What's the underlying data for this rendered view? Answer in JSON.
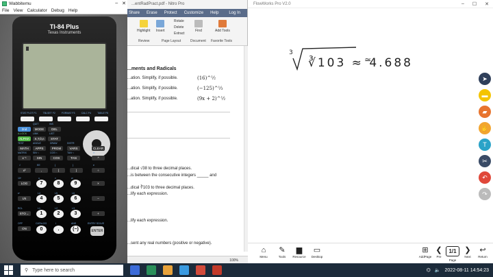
{
  "wabbit": {
    "title": "Wabbitemu",
    "menu": [
      "File",
      "View",
      "Calculator",
      "Debug",
      "Help"
    ],
    "calc": {
      "model": "TI-84 Plus",
      "maker": "Texas Instruments",
      "fn_labels": [
        "STAT PLOT F1",
        "TBLSET F2",
        "FORMAT F3",
        "CALC F4",
        "TABLE F5"
      ],
      "keys": {
        "second": "2nd",
        "mode": "MODE",
        "del": "DEL",
        "alpha": "ALPHA",
        "xton": "X,T,θ,n",
        "stat": "STAT",
        "math": "MATH",
        "apps": "APPS",
        "prgm": "PRGM",
        "vars": "VARS",
        "clear": "CLEAR",
        "xinv": "x⁻¹",
        "sin": "SIN",
        "cos": "COS",
        "tan": "TAN",
        "pow": "^",
        "sq": "x²",
        "comma": ",",
        "lparen": "(",
        "rparen": ")",
        "div": "÷",
        "log": "LOG",
        "n7": "7",
        "n8": "8",
        "n9": "9",
        "mul": "×",
        "ln": "LN",
        "n4": "4",
        "n5": "5",
        "n6": "6",
        "sub": "−",
        "sto": "STO→",
        "n1": "1",
        "n2": "2",
        "n3": "3",
        "add": "+",
        "on": "ON",
        "n0": "0",
        "dot": ".",
        "neg": "(−)",
        "enter": "ENTER"
      },
      "sub": {
        "quit": "QUIT",
        "ins": "INS",
        "alock": "A-LOCK",
        "link": "LINK",
        "list": "LIST",
        "test": "TEST",
        "angle": "ANGLE",
        "draw": "DRAW",
        "distr": "DISTR",
        "matrix": "MATRIX",
        "sininv": "SIN⁻¹",
        "cosinv": "COS⁻¹",
        "taninv": "TAN⁻¹",
        "pi": "π",
        "sqrt": "√",
        "ee": "EE",
        "lbrace": "{",
        "rbrace": "}",
        "e": "e",
        "tenx": "10ˣ",
        "u": "u",
        "v": "v",
        "w": "w",
        "ex": "eˣ",
        "l4": "L4",
        "l5": "L5",
        "l6": "L6",
        "rcl": "RCL",
        "l1": "L1",
        "l2": "L2",
        "l3": "L3",
        "off": "OFF",
        "catalog": "CATALOG",
        "i": "i",
        "ans": "ANS",
        "entry": "ENTRY SOLVE"
      }
    }
  },
  "nitro": {
    "title": "...entRadPract.pdf - Nitro Pro",
    "tabs": [
      "Share",
      "Erase",
      "Protect",
      "Customize",
      "Help",
      "Log In"
    ],
    "ribbon": {
      "highlight": "Highlight",
      "insert": "Insert",
      "rotate": "Rotate",
      "delete": "Delete",
      "extract": "Extract",
      "find": "Find",
      "add_tools": "Add Tools",
      "groups": [
        "Review",
        "Page Layout",
        "Document",
        "Favorite Tools"
      ]
    },
    "doc": {
      "heading": "...ments and Radicals",
      "l1": "...ation.  Simplify, if possible.",
      "l2": "...ation.  Simplify, if possible.",
      "l3": "...ation.  Simplify, if possible.",
      "e1": "(16)^½",
      "e2": "(−125)^⅓",
      "e3": "(9x + 2)^½",
      "l4": "...dical √38 to three decimal places.",
      "l5": "...is between the consecutive integers _____ and",
      "l6": "...dical ∛103 to three decimal places.",
      "l7": "...lify each expression.",
      "l8": "...lify each expression.",
      "l9": "...sent any real numbers (positive or negative)."
    },
    "status": {
      "zoom": "100%"
    }
  },
  "flow": {
    "title": "FlowWorks Pro V2.0",
    "math": "∛103 ≈ 4.688",
    "bottom": [
      "Menu",
      "Tools",
      "Resource",
      "Desktop",
      "AddPage",
      "Pre",
      "Page",
      "Next",
      "Return"
    ],
    "page": "1/1"
  },
  "taskbar": {
    "search_placeholder": "Type here to search",
    "datetime": "2022-08-11  14:54:23"
  },
  "colors": {
    "nitro_tabs": "#5a6c8a",
    "taskbar": "#1c2b3a",
    "calc_screen": "#aab49a"
  }
}
